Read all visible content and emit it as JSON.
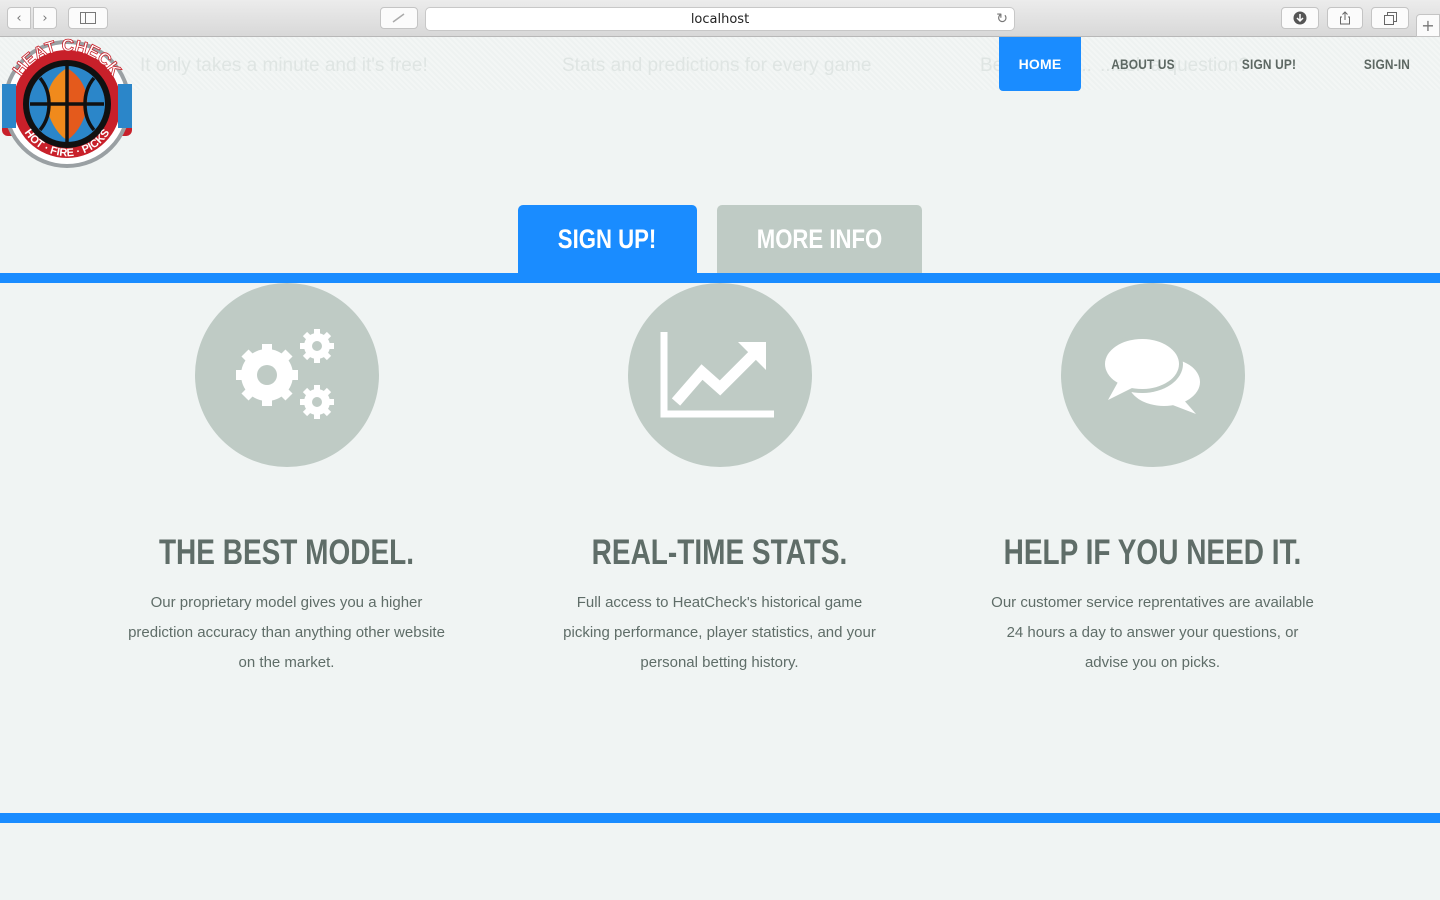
{
  "browser": {
    "url": "localhost"
  },
  "hero": {
    "ghost_texts": [
      "It only takes a minute and it's free!",
      "Stats and predictions for every game",
      "Be the next...",
      "...ask a question?"
    ]
  },
  "nav": {
    "items": [
      {
        "label": "HOME",
        "active": true
      },
      {
        "label": "ABOUT US",
        "active": false
      },
      {
        "label": "SIGN UP!",
        "active": false
      },
      {
        "label": "SIGN-IN",
        "active": false
      }
    ]
  },
  "logo": {
    "text_top": "HEAT CHECK",
    "text_bottom": "HOT · FIRE · PICKS"
  },
  "cta": {
    "signup_label": "SIGN UP!",
    "more_info_label": "MORE INFO"
  },
  "colors": {
    "accent": "#1a8cff",
    "muted": "#bfcbc5",
    "text": "#5f6d68",
    "background": "#f0f4f3"
  },
  "features": [
    {
      "icon": "gears-icon",
      "title": "THE BEST MODEL.",
      "description": "Our proprietary model gives you a higher prediction accuracy than anything other website on the market."
    },
    {
      "icon": "line-chart-icon",
      "title": "REAL-TIME STATS.",
      "description": "Full access to HeatCheck's historical game picking performance, player statistics, and your personal betting history."
    },
    {
      "icon": "chat-bubbles-icon",
      "title": "HELP IF YOU NEED IT.",
      "description": "Our customer service reprentatives are available 24 hours a day to answer your questions, or advise you on picks."
    }
  ]
}
